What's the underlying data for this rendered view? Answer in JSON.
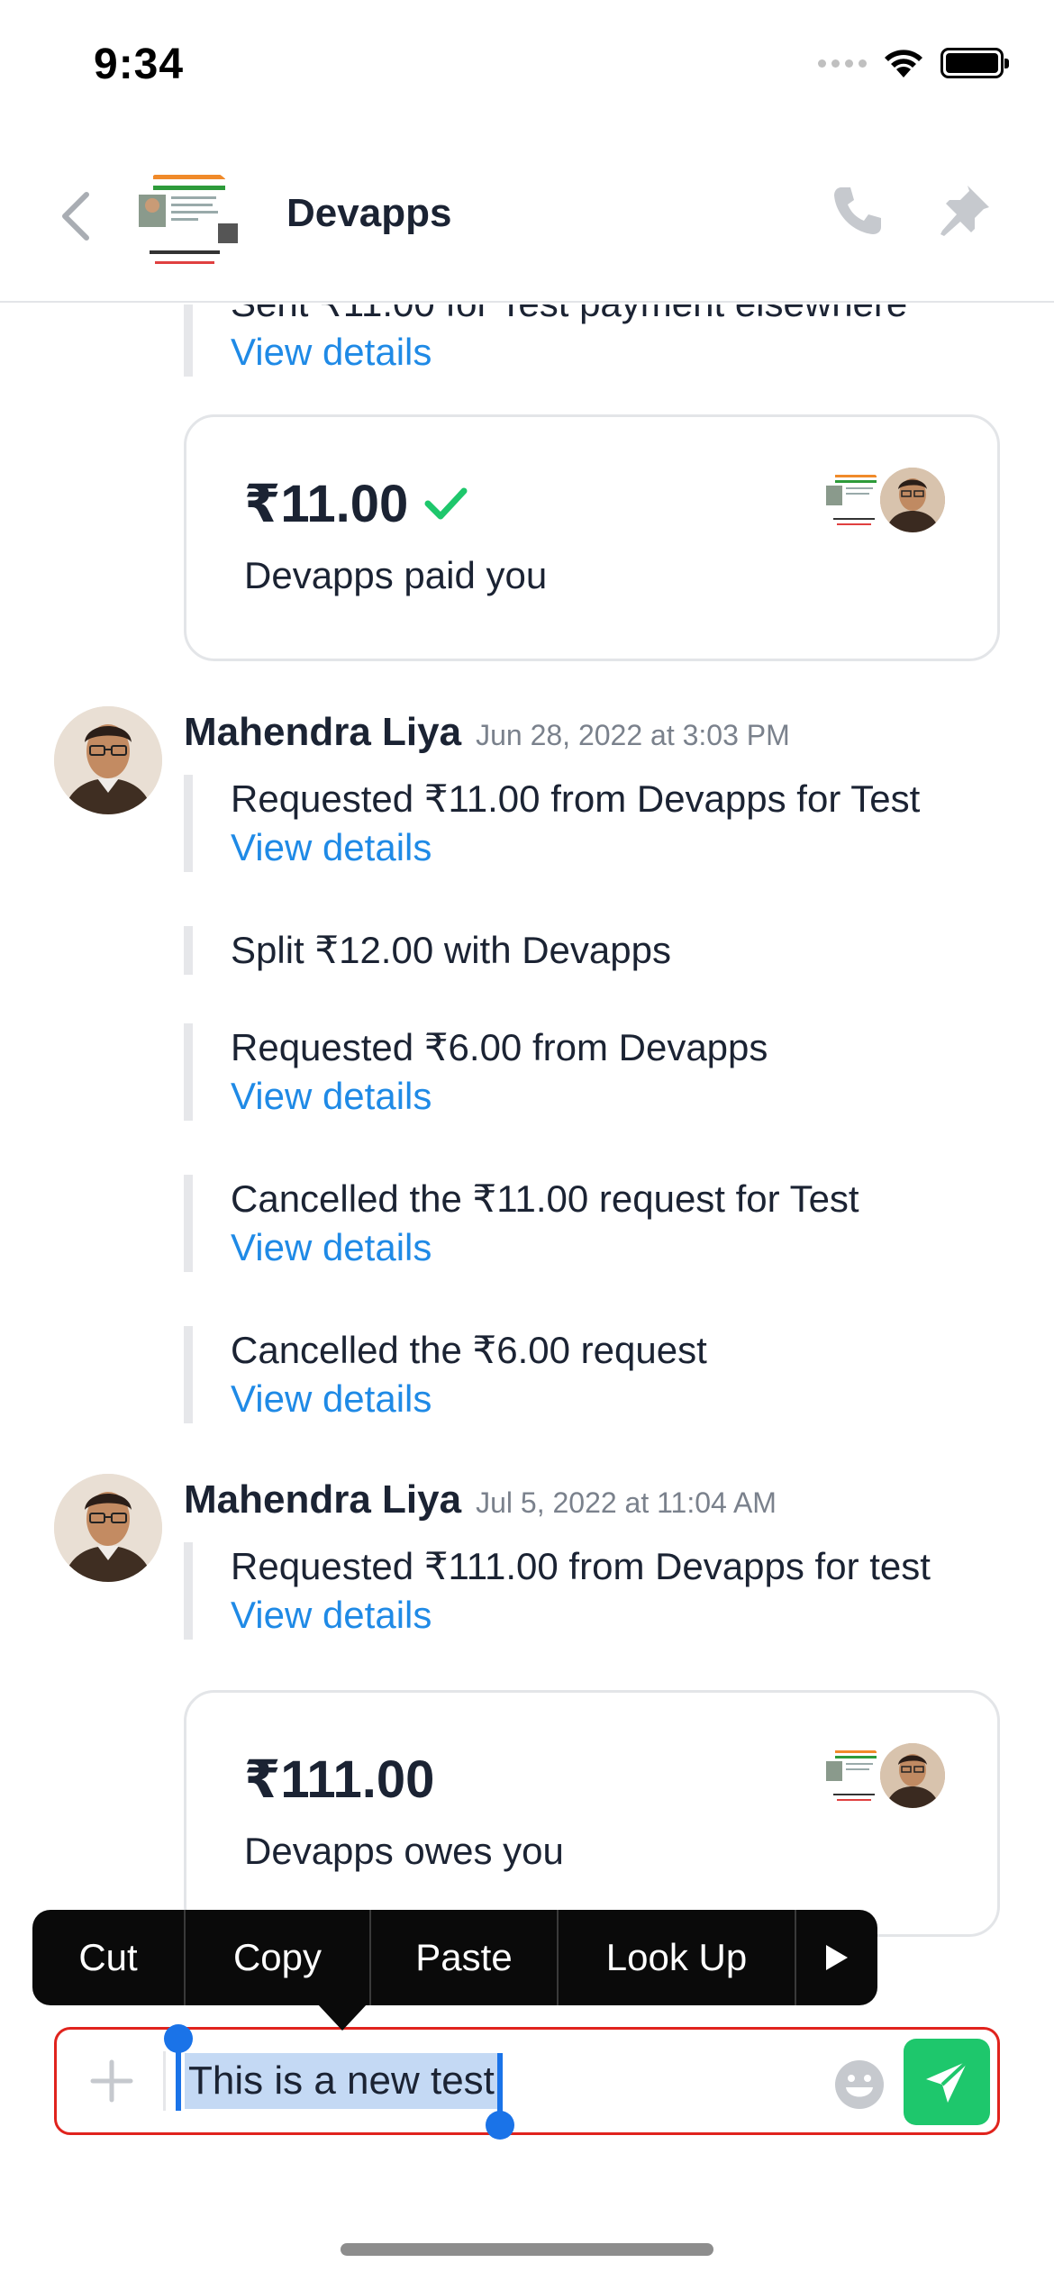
{
  "status_bar": {
    "time": "9:34"
  },
  "header": {
    "contact_name": "Devapps"
  },
  "messages": {
    "top_partial_text": "Sent ₹11.00 for Test payment elsewhere",
    "top_partial_link": "View details",
    "card1": {
      "amount": "₹11.00",
      "subtitle": "Devapps paid you",
      "paid": true
    },
    "group1": {
      "sender": "Mahendra Liya",
      "time": "Jun 28, 2022 at 3:03 PM",
      "items": [
        {
          "text": "Requested ₹11.00 from Devapps for Test",
          "link": "View details"
        },
        {
          "text": "Split ₹12.00 with Devapps"
        },
        {
          "text": "Requested ₹6.00 from Devapps",
          "link": "View details"
        },
        {
          "text": "Cancelled the ₹11.00 request for Test",
          "link": "View details"
        },
        {
          "text": "Cancelled the ₹6.00 request",
          "link": "View details"
        }
      ]
    },
    "group2": {
      "sender": "Mahendra Liya",
      "time": "Jul 5, 2022 at 11:04 AM",
      "items": [
        {
          "text": "Requested ₹111.00 from Devapps for test",
          "link": "View details"
        }
      ]
    },
    "card2": {
      "amount": "₹111.00",
      "subtitle": "Devapps owes you"
    }
  },
  "context_menu": {
    "cut": "Cut",
    "copy": "Copy",
    "paste": "Paste",
    "look_up": "Look Up"
  },
  "composer": {
    "value": "This is a new test"
  },
  "colors": {
    "accent_link": "#1f8ae6",
    "send_green": "#1ec76c",
    "check_green": "#1ec76c",
    "focus_border": "#e0231d",
    "selection": "#c4d9f4"
  }
}
